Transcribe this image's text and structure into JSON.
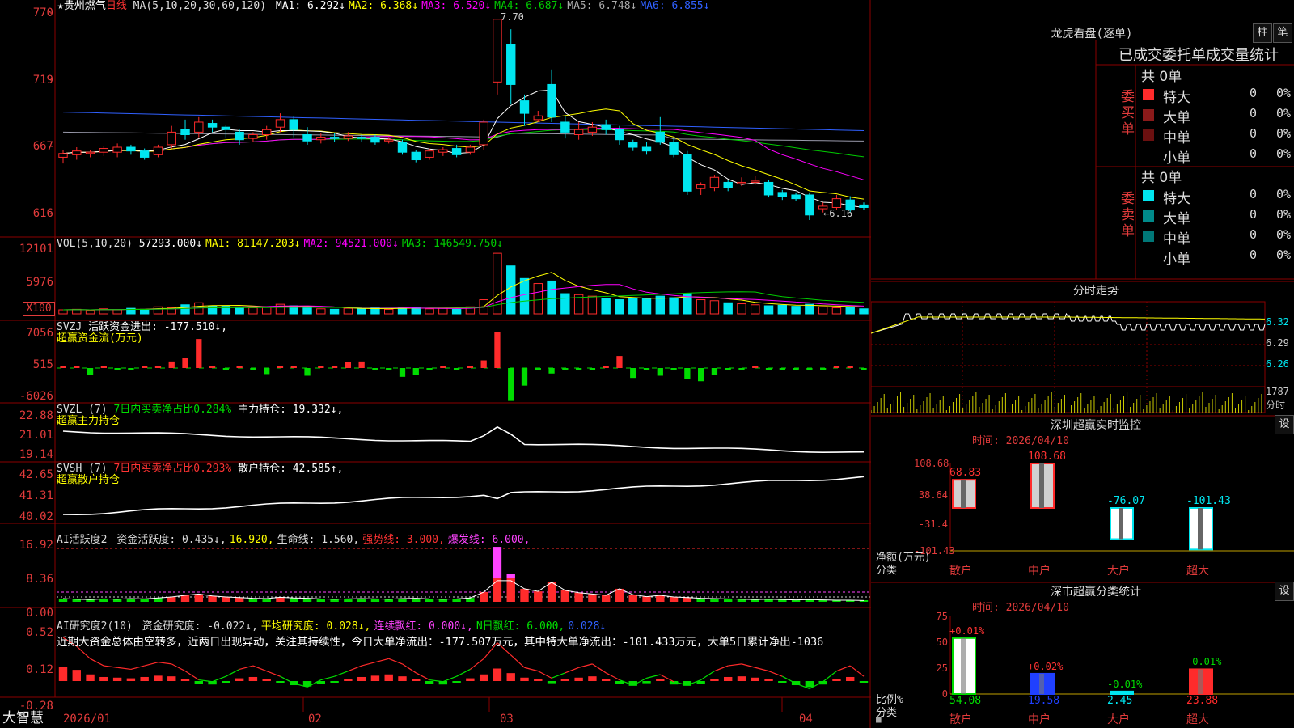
{
  "colors": {
    "up": "#ff2b2b",
    "down": "#00e6f0",
    "ma1": "#ffffff",
    "ma2": "#ffff00",
    "ma3": "#ff00ff",
    "ma4": "#00cc00",
    "ma5": "#9999aa",
    "ma6": "#3060ff",
    "grid": "#8b0000",
    "green": "#00dd00",
    "pink": "#ff44ff"
  },
  "main": {
    "stock_name": "★贵州燃气",
    "period": "日线",
    "ma_params": "MA(5,10,20,30,60,120)",
    "ma_items": [
      {
        "label": "MA1:",
        "value": "6.292↓",
        "color": "#ffffff"
      },
      {
        "label": "MA2:",
        "value": "6.368↓",
        "color": "#ffff00"
      },
      {
        "label": "MA3:",
        "value": "6.520↓",
        "color": "#ff00ff"
      },
      {
        "label": "MA4:",
        "value": "6.687↓",
        "color": "#00cc00"
      },
      {
        "label": "MA5:",
        "value": "6.748↓",
        "color": "#aaaaaa"
      },
      {
        "label": "MA6:",
        "value": "6.855↓",
        "color": "#3060ff"
      }
    ],
    "y_ticks": [
      "770",
      "719",
      "667",
      "616"
    ],
    "high_label": "7.70",
    "low_label": "←6.16"
  },
  "vol": {
    "title": "VOL(5,10,20)",
    "value": "57293.000↓",
    "items": [
      {
        "label": "MA1:",
        "value": "81147.203↓",
        "color": "#ffff00"
      },
      {
        "label": "MA2:",
        "value": "94521.000↓",
        "color": "#ff00ff"
      },
      {
        "label": "MA3:",
        "value": "146549.750↓",
        "color": "#00cc00"
      }
    ],
    "y_ticks": [
      "12101",
      "5976"
    ],
    "unit": "X100"
  },
  "svzj": {
    "title": "SVZJ",
    "item": "活跃资金进出: -177.510↓,",
    "sub": "超赢资金流(万元)",
    "y_ticks": [
      "7056",
      "515",
      "-6026"
    ]
  },
  "svzl": {
    "title": "SVZL (7)",
    "item1": "7日内买卖净占比0.284%",
    "item2": "主力持仓: 19.332↓,",
    "sub": "超赢主力持仓",
    "y_ticks": [
      "22.88",
      "21.01",
      "19.14"
    ]
  },
  "svsh": {
    "title": "SVSH (7)",
    "item1": "7日内买卖净占比0.293%",
    "item2": "散户持仓: 42.585↑,",
    "sub": "超赢散户持仓",
    "y_ticks": [
      "42.65",
      "41.31",
      "40.02"
    ]
  },
  "ai1": {
    "title": "AI活跃度2",
    "items": [
      {
        "t": "资金活跃度: 0.435↓,",
        "c": "#dddddd"
      },
      {
        "t": "16.920,",
        "c": "#ffff00"
      },
      {
        "t": "生命线: 1.560,",
        "c": "#dddddd"
      },
      {
        "t": "强势线: 3.000,",
        "c": "#ff3333"
      },
      {
        "t": "爆发线: 6.000,",
        "c": "#ff44ff"
      }
    ],
    "y_ticks": [
      "16.92",
      "8.36",
      "0.00"
    ]
  },
  "ai2": {
    "title": "AI研究度2(10)",
    "items": [
      {
        "t": "资金研究度: -0.022↓,",
        "c": "#dddddd"
      },
      {
        "t": "平均研究度: 0.028↓,",
        "c": "#ffff00"
      },
      {
        "t": "连续飘红: 0.000↓,",
        "c": "#ff44ff"
      },
      {
        "t": "N日飘红: 6.000,",
        "c": "#00dd00"
      },
      {
        "t": "0.028↓",
        "c": "#3060ff"
      }
    ],
    "comment": "近期大资金总体由空转多，近两日出现异动，关注其持续性，今日大单净流出：-177.507万元，其中特大单净流出：-101.433万元，大单5日累计净出-1036",
    "y_ticks": [
      "0.52",
      "0.12",
      "-0.28"
    ]
  },
  "x_axis": {
    "labels": [
      "2026/01",
      "02",
      "03",
      "04"
    ]
  },
  "footer": {
    "brand": "大智慧"
  },
  "longhu": {
    "title": "龙虎看盘(逐单)",
    "btn1": "柱",
    "btn2": "笔",
    "header": "已成交委托单成交量统计",
    "buy": {
      "side": "委买单",
      "total": "共 0单",
      "rows": [
        {
          "name": "特大",
          "v": "0",
          "p": "0%",
          "c": "#ff2b2b"
        },
        {
          "name": "大单",
          "v": "0",
          "p": "0%",
          "c": "#8b1a1a"
        },
        {
          "name": "中单",
          "v": "0",
          "p": "0%",
          "c": "#6b1010"
        },
        {
          "name": "小单",
          "v": "0",
          "p": "0%",
          "c": ""
        }
      ]
    },
    "sell": {
      "side": "委卖单",
      "total": "共 0单",
      "rows": [
        {
          "name": "特大",
          "v": "0",
          "p": "0%",
          "c": "#00e6f0"
        },
        {
          "name": "大单",
          "v": "0",
          "p": "0%",
          "c": "#008a8a"
        },
        {
          "name": "中单",
          "v": "0",
          "p": "0%",
          "c": "#007777"
        },
        {
          "name": "小单",
          "v": "0",
          "p": "0%",
          "c": ""
        }
      ]
    }
  },
  "intraday": {
    "title": "分时走势",
    "prices": [
      "6.32",
      "6.29",
      "6.26"
    ],
    "vol": "1787",
    "unit": "分时"
  },
  "sz_monitor": {
    "title": "深圳超赢实时监控",
    "btn": "设",
    "date": "时间: 2026/04/10",
    "y_ticks": [
      "108.68",
      "38.64",
      "-31.4",
      "-101.43"
    ],
    "ylabel": "净额(万元)",
    "xlabel": "分类",
    "bars": [
      {
        "cat": "散户",
        "v": 68.83,
        "lbl": "68.83"
      },
      {
        "cat": "中户",
        "v": 108.68,
        "lbl": "108.68"
      },
      {
        "cat": "大户",
        "v": -76.07,
        "lbl": "-76.07"
      },
      {
        "cat": "超大",
        "v": -101.43,
        "lbl": "-101.43"
      }
    ]
  },
  "sh_stats": {
    "title": "深市超赢分类统计",
    "btn": "设",
    "date": "时间: 2026/04/10",
    "y_ticks": [
      "75",
      "50",
      "25",
      "0"
    ],
    "ylabel": "比例%",
    "xlabel": "分类",
    "bars": [
      {
        "cat": "散户",
        "v": 54.08,
        "lbl": "54.08",
        "chg": "+0.01%",
        "color": "#ffffff",
        "cc": "#ff3333"
      },
      {
        "cat": "中户",
        "v": 19.58,
        "lbl": "19.58",
        "chg": "+0.02%",
        "color": "#2040ff",
        "cc": "#ff3333"
      },
      {
        "cat": "大户",
        "v": 2.45,
        "lbl": "2.45",
        "chg": "-0.01%",
        "color": "#00e6f0",
        "cc": "#00dd00"
      },
      {
        "cat": "超大",
        "v": 23.88,
        "lbl": "23.88",
        "chg": "-0.01%",
        "color": "#ff2b2b",
        "cc": "#00dd00"
      }
    ]
  },
  "chart_data": {
    "type": "candlestick",
    "title": "贵州燃气 日线",
    "x_months": [
      "2026/01",
      "02",
      "03",
      "04"
    ],
    "ylim": [
      6.1,
      7.75
    ],
    "candles": [
      [
        6.6,
        6.63,
        6.55,
        6.66
      ],
      [
        6.62,
        6.65,
        6.58,
        6.68
      ],
      [
        6.63,
        6.64,
        6.6,
        6.66
      ],
      [
        6.64,
        6.67,
        6.61,
        6.69
      ],
      [
        6.64,
        6.68,
        6.6,
        6.71
      ],
      [
        6.68,
        6.65,
        6.62,
        6.7
      ],
      [
        6.65,
        6.6,
        6.58,
        6.67
      ],
      [
        6.62,
        6.68,
        6.6,
        6.7
      ],
      [
        6.7,
        6.8,
        6.67,
        6.85
      ],
      [
        6.82,
        6.78,
        6.74,
        6.9
      ],
      [
        6.8,
        6.88,
        6.76,
        6.92
      ],
      [
        6.87,
        6.84,
        6.8,
        6.9
      ],
      [
        6.84,
        6.82,
        6.75,
        6.86
      ],
      [
        6.8,
        6.74,
        6.7,
        6.82
      ],
      [
        6.75,
        6.78,
        6.72,
        6.8
      ],
      [
        6.78,
        6.82,
        6.74,
        6.85
      ],
      [
        6.84,
        6.9,
        6.8,
        6.95
      ],
      [
        6.9,
        6.82,
        6.76,
        6.93
      ],
      [
        6.78,
        6.73,
        6.7,
        6.84
      ],
      [
        6.74,
        6.76,
        6.71,
        6.79
      ],
      [
        6.76,
        6.75,
        6.72,
        6.79
      ],
      [
        6.75,
        6.77,
        6.73,
        6.8
      ],
      [
        6.76,
        6.75,
        6.72,
        6.78
      ],
      [
        6.76,
        6.72,
        6.7,
        6.78
      ],
      [
        6.73,
        6.74,
        6.71,
        6.76
      ],
      [
        6.72,
        6.64,
        6.62,
        6.74
      ],
      [
        6.64,
        6.58,
        6.56,
        6.66
      ],
      [
        6.6,
        6.65,
        6.58,
        6.67
      ],
      [
        6.64,
        6.66,
        6.61,
        6.68
      ],
      [
        6.67,
        6.62,
        6.6,
        6.7
      ],
      [
        6.64,
        6.68,
        6.62,
        6.7
      ],
      [
        6.7,
        6.88,
        6.66,
        6.9
      ],
      [
        7.2,
        7.7,
        7.1,
        7.7
      ],
      [
        7.5,
        7.18,
        7.02,
        7.62
      ],
      [
        7.05,
        6.95,
        6.85,
        7.1
      ],
      [
        6.9,
        6.93,
        6.88,
        6.97
      ],
      [
        7.18,
        6.92,
        6.88,
        7.3
      ],
      [
        6.88,
        6.8,
        6.75,
        6.93
      ],
      [
        6.78,
        6.82,
        6.74,
        6.88
      ],
      [
        6.8,
        6.84,
        6.77,
        6.88
      ],
      [
        6.86,
        6.82,
        6.78,
        6.9
      ],
      [
        6.82,
        6.74,
        6.7,
        6.85
      ],
      [
        6.72,
        6.68,
        6.65,
        6.74
      ],
      [
        6.68,
        6.65,
        6.62,
        6.72
      ],
      [
        6.8,
        6.72,
        6.7,
        6.92
      ],
      [
        6.72,
        6.62,
        6.6,
        6.75
      ],
      [
        6.62,
        6.33,
        6.3,
        6.65
      ],
      [
        6.35,
        6.38,
        6.3,
        6.4
      ],
      [
        6.36,
        6.44,
        6.33,
        6.46
      ],
      [
        6.4,
        6.36,
        6.33,
        6.42
      ],
      [
        6.39,
        6.4,
        6.37,
        6.44
      ],
      [
        6.4,
        6.41,
        6.38,
        6.45
      ],
      [
        6.4,
        6.3,
        6.28,
        6.42
      ],
      [
        6.32,
        6.29,
        6.26,
        6.34
      ],
      [
        6.3,
        6.27,
        6.25,
        6.32
      ],
      [
        6.3,
        6.14,
        6.1,
        6.32
      ],
      [
        6.19,
        6.21,
        6.16,
        6.24
      ],
      [
        6.2,
        6.27,
        6.18,
        6.3
      ],
      [
        6.26,
        6.18,
        6.16,
        6.29
      ],
      [
        6.22,
        6.2,
        6.18,
        6.24
      ]
    ],
    "volume": [
      8,
      9,
      7,
      10,
      8,
      11,
      9,
      14,
      12,
      18,
      22,
      16,
      15,
      13,
      12,
      14,
      19,
      16,
      14,
      10,
      9,
      11,
      10,
      12,
      9,
      13,
      12,
      10,
      11,
      9,
      14,
      28,
      120,
      95,
      70,
      60,
      65,
      40,
      38,
      35,
      30,
      28,
      32,
      30,
      35,
      32,
      40,
      28,
      26,
      22,
      20,
      18,
      16,
      17,
      15,
      19,
      14,
      12,
      13,
      10
    ],
    "svzj": [
      0.5,
      0.3,
      -1.2,
      0.4,
      -0.6,
      -0.4,
      0.6,
      0.8,
      1.2,
      1.8,
      5.3,
      0.4,
      -0.6,
      0.7,
      -0.8,
      -1.1,
      0.9,
      0.7,
      -1.4,
      0.6,
      0.4,
      1.1,
      1.2,
      -0.4,
      -0.8,
      -1.6,
      -1.2,
      -0.5,
      0.3,
      -0.6,
      0.8,
      1.4,
      6.5,
      -6.0,
      -3.2,
      -0.4,
      -1.0,
      -0.4,
      -0.5,
      -0.6,
      0.3,
      2.2,
      -1.8,
      -0.3,
      -1.4,
      -0.5,
      -2.0,
      -2.4,
      -1.3,
      -0.6,
      -0.3,
      0.2,
      -0.5,
      -0.3,
      -0.4,
      -0.6,
      -0.3,
      0.2,
      0.3,
      -0.2
    ],
    "ai1": [
      1.0,
      0.8,
      0.7,
      0.9,
      0.8,
      1.0,
      0.9,
      1.2,
      1.5,
      2.0,
      2.4,
      1.8,
      1.5,
      1.3,
      1.1,
      1.0,
      1.4,
      1.2,
      1.1,
      0.9,
      0.8,
      0.9,
      1.0,
      0.9,
      0.8,
      1.0,
      1.1,
      0.9,
      0.8,
      0.9,
      1.2,
      3.0,
      16.9,
      8.5,
      4.0,
      3.2,
      6.0,
      3.5,
      2.8,
      2.4,
      2.0,
      4.0,
      2.2,
      1.6,
      2.0,
      1.5,
      1.3,
      1.1,
      1.0,
      0.9,
      0.8,
      0.7,
      0.8,
      0.7,
      0.6,
      0.7,
      0.6,
      0.5,
      0.5,
      0.4
    ],
    "ai2": [
      0.42,
      0.32,
      0.18,
      0.1,
      0.08,
      0.06,
      0.1,
      0.14,
      0.12,
      0.04,
      -0.06,
      -0.08,
      -0.02,
      0.06,
      0.1,
      0.04,
      -0.02,
      -0.1,
      -0.14,
      -0.06,
      -0.02,
      0.04,
      0.1,
      0.14,
      0.18,
      0.12,
      0.02,
      -0.06,
      -0.08,
      -0.02,
      0.06,
      0.18,
      0.36,
      0.22,
      0.08,
      0.04,
      -0.04,
      0.02,
      0.08,
      0.12,
      0.02,
      -0.06,
      -0.12,
      -0.04,
      0.0,
      -0.08,
      -0.12,
      -0.06,
      0.04,
      0.1,
      0.12,
      0.08,
      0.04,
      -0.02,
      -0.1,
      -0.16,
      -0.08,
      0.04,
      0.1,
      -0.02
    ]
  }
}
